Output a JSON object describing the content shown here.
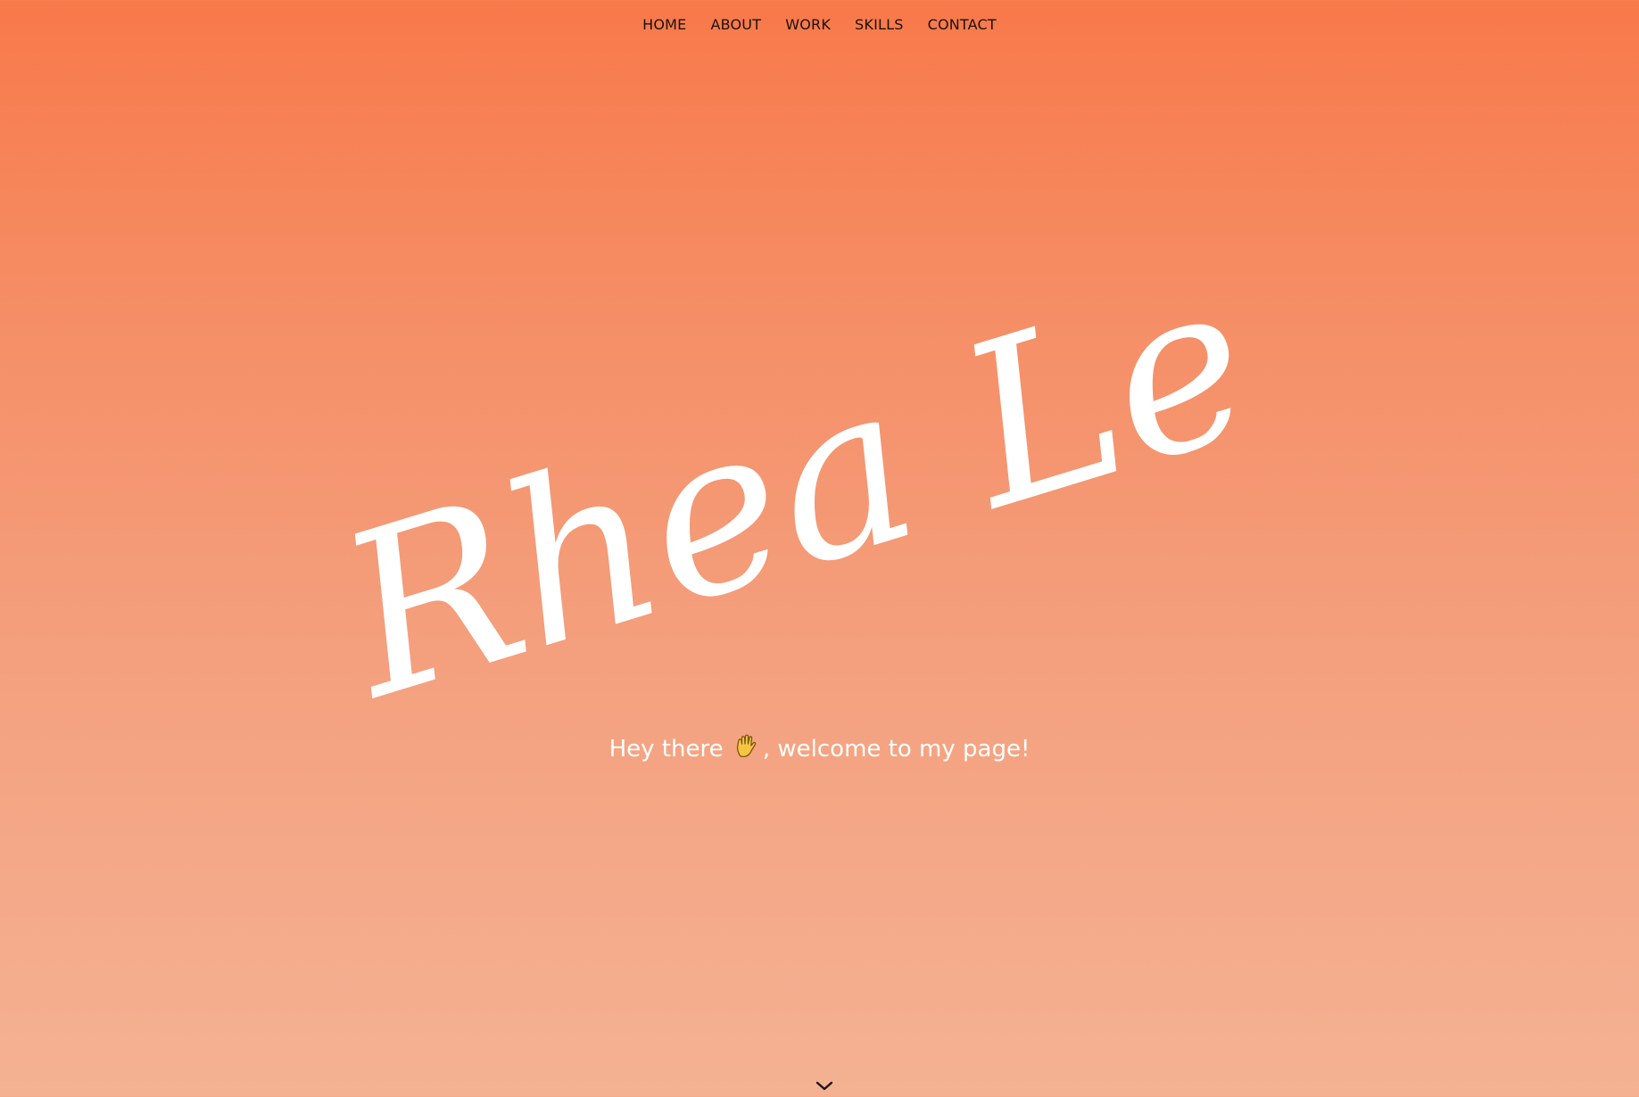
{
  "nav": {
    "items": [
      {
        "label": "HOME"
      },
      {
        "label": "ABOUT"
      },
      {
        "label": "WORK"
      },
      {
        "label": "SKILLS"
      },
      {
        "label": "CONTACT"
      }
    ]
  },
  "hero": {
    "name": "Rhea Le",
    "greeting_before": "Hey there",
    "greeting_icon": "waving-hand-icon",
    "greeting_after": ", welcome to my page!"
  },
  "scroll": {
    "icon": "chevron-down-icon"
  },
  "colors": {
    "gradient_top": "#f8794a",
    "gradient_bottom": "#f4b293",
    "text_light": "#ffffff",
    "nav_text": "#1a1210"
  }
}
